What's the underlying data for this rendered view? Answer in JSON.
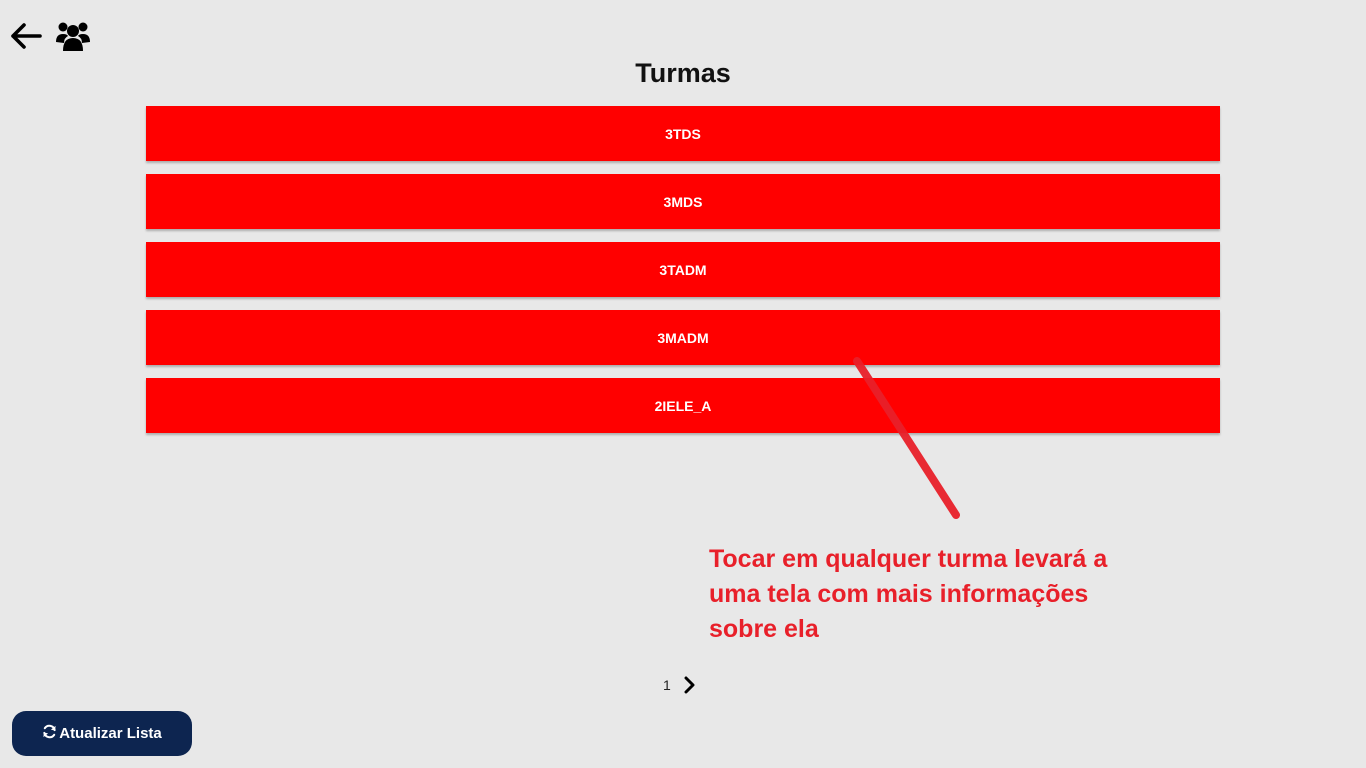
{
  "header": {
    "back_icon": "arrow-left-icon",
    "group_icon": "users-group-icon"
  },
  "title": "Turmas",
  "classes": [
    {
      "label": "3TDS"
    },
    {
      "label": "3MDS"
    },
    {
      "label": "3TADM"
    },
    {
      "label": "3MADM"
    },
    {
      "label": "2IELE_A"
    }
  ],
  "annotation": {
    "text": "Tocar em qualquer turma levará a uma tela com mais informações sobre ela",
    "color": "#e8202a"
  },
  "pagination": {
    "current_page": "1",
    "next_icon": "chevron-right-icon"
  },
  "refresh_button": {
    "label": "Atualizar Lista",
    "icon": "refresh-icon"
  },
  "colors": {
    "background": "#e8e8e8",
    "class_item": "#ff0000",
    "button": "#0d2550"
  }
}
